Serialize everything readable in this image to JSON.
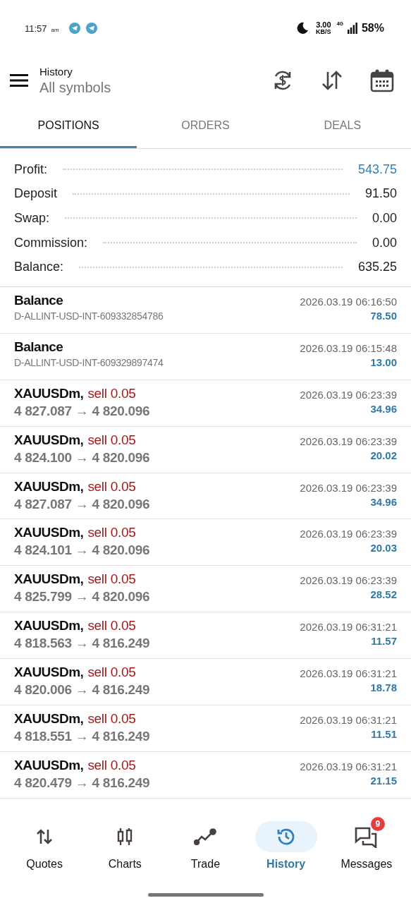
{
  "status_bar": {
    "time": "11:57",
    "ampm": "am",
    "speed": "3.00",
    "speed_unit": "KB/S",
    "network": "4G",
    "battery": "58%"
  },
  "header": {
    "title": "History",
    "subtitle": "All symbols"
  },
  "tabs": [
    {
      "label": "POSITIONS",
      "selected": true
    },
    {
      "label": "ORDERS",
      "selected": false
    },
    {
      "label": "DEALS",
      "selected": false
    }
  ],
  "summary": [
    {
      "label": "Profit:",
      "value": "543.75",
      "highlight": true
    },
    {
      "label": "Deposit",
      "value": "91.50",
      "highlight": false
    },
    {
      "label": "Swap:",
      "value": "0.00",
      "highlight": false
    },
    {
      "label": "Commission:",
      "value": "0.00",
      "highlight": false
    },
    {
      "label": "Balance:",
      "value": "635.25",
      "highlight": false
    }
  ],
  "rows": [
    {
      "kind": "balance",
      "title": "Balance",
      "detail": "D-ALLINT-USD-INT-609332854786",
      "time": "2026.03.19 06:16:50",
      "profit": "78.50"
    },
    {
      "kind": "balance",
      "title": "Balance",
      "detail": "D-ALLINT-USD-INT-609329897474",
      "time": "2026.03.19 06:15:48",
      "profit": "13.00"
    },
    {
      "kind": "trade",
      "title": "XAUUSDm,",
      "side": "sell 0.05",
      "detail": "4 827.087 → 4 820.096",
      "time": "2026.03.19 06:23:39",
      "profit": "34.96"
    },
    {
      "kind": "trade",
      "title": "XAUUSDm,",
      "side": "sell 0.05",
      "detail": "4 824.100 → 4 820.096",
      "time": "2026.03.19 06:23:39",
      "profit": "20.02"
    },
    {
      "kind": "trade",
      "title": "XAUUSDm,",
      "side": "sell 0.05",
      "detail": "4 827.087 → 4 820.096",
      "time": "2026.03.19 06:23:39",
      "profit": "34.96"
    },
    {
      "kind": "trade",
      "title": "XAUUSDm,",
      "side": "sell 0.05",
      "detail": "4 824.101 → 4 820.096",
      "time": "2026.03.19 06:23:39",
      "profit": "20.03"
    },
    {
      "kind": "trade",
      "title": "XAUUSDm,",
      "side": "sell 0.05",
      "detail": "4 825.799 → 4 820.096",
      "time": "2026.03.19 06:23:39",
      "profit": "28.52"
    },
    {
      "kind": "trade",
      "title": "XAUUSDm,",
      "side": "sell 0.05",
      "detail": "4 818.563 → 4 816.249",
      "time": "2026.03.19 06:31:21",
      "profit": "11.57"
    },
    {
      "kind": "trade",
      "title": "XAUUSDm,",
      "side": "sell 0.05",
      "detail": "4 820.006 → 4 816.249",
      "time": "2026.03.19 06:31:21",
      "profit": "18.78"
    },
    {
      "kind": "trade",
      "title": "XAUUSDm,",
      "side": "sell 0.05",
      "detail": "4 818.551 → 4 816.249",
      "time": "2026.03.19 06:31:21",
      "profit": "11.51"
    },
    {
      "kind": "trade",
      "title": "XAUUSDm,",
      "side": "sell 0.05",
      "detail": "4 820.479 → 4 816.249",
      "time": "2026.03.19 06:31:21",
      "profit": "21.15"
    }
  ],
  "nav": [
    {
      "label": "Quotes",
      "kind": "quotes",
      "selected": false
    },
    {
      "label": "Charts",
      "kind": "charts",
      "selected": false
    },
    {
      "label": "Trade",
      "kind": "trade",
      "selected": false
    },
    {
      "label": "History",
      "kind": "history",
      "selected": true
    },
    {
      "label": "Messages",
      "kind": "messages",
      "selected": false,
      "badge": "9"
    }
  ]
}
